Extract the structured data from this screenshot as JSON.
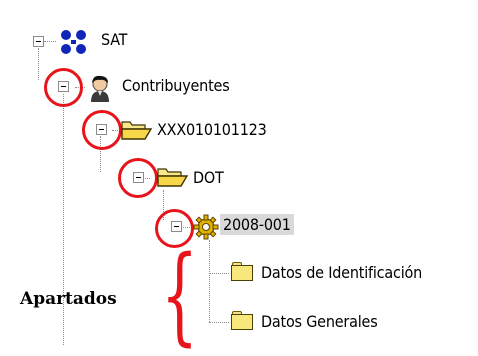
{
  "tree": {
    "root_label": "SAT",
    "contribuyentes_label": "Contribuyentes",
    "rfc_label": "XXX010101123",
    "dot_label": "DOT",
    "record_label": "2008-001",
    "child1_label": "Datos de Identificación",
    "child2_label": "Datos Generales"
  },
  "annotation": {
    "label": "Apartados",
    "brace_glyph": "{",
    "color": "#e8141b"
  },
  "icons": {
    "root": "sat-network-icon",
    "contribuyentes": "user-icon",
    "rfc": "open-folder-icon",
    "dot": "open-folder-icon",
    "record": "gear-icon",
    "children": "folder-icon"
  }
}
